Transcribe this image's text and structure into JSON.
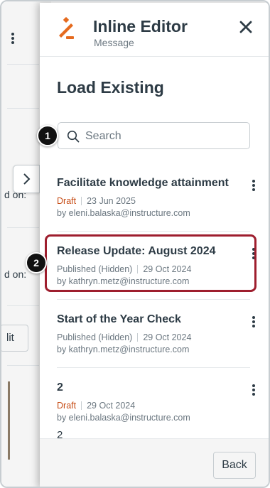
{
  "background": {
    "labels": [
      "d on:",
      "d on:"
    ],
    "button_label": "lit"
  },
  "drawer": {
    "title": "Inline Editor",
    "subtitle": "Message",
    "section_title": "Load Existing",
    "search": {
      "placeholder": "Search",
      "value": ""
    },
    "items": [
      {
        "title": "Facilitate knowledge attainment",
        "status": "Draft",
        "date": "23 Jun 2025",
        "author": "by eleni.balaska@instructure.com",
        "extra": ""
      },
      {
        "title": "Release Update: August 2024",
        "status": "Published (Hidden)",
        "date": "29 Oct 2024",
        "author": "by kathryn.metz@instructure.com",
        "extra": ""
      },
      {
        "title": "Start of the Year Check",
        "status": "Published (Hidden)",
        "date": "29 Oct 2024",
        "author": "by kathryn.metz@instructure.com",
        "extra": ""
      },
      {
        "title": "2",
        "status": "Draft",
        "date": "29 Oct 2024",
        "author": "by eleni.balaska@instructure.com",
        "extra": "2"
      }
    ],
    "footer": {
      "back_label": "Back"
    }
  },
  "badges": [
    "1",
    "2"
  ],
  "colors": {
    "accent": "#e56a1e",
    "draft": "#c64b14",
    "highlight": "#9e1e2e"
  },
  "icons": {
    "logo": "canvas-inline-editor-logo",
    "close": "close-icon",
    "search": "search-icon",
    "toggle": "chevron-right-icon",
    "kebab": "more-vertical-icon"
  }
}
